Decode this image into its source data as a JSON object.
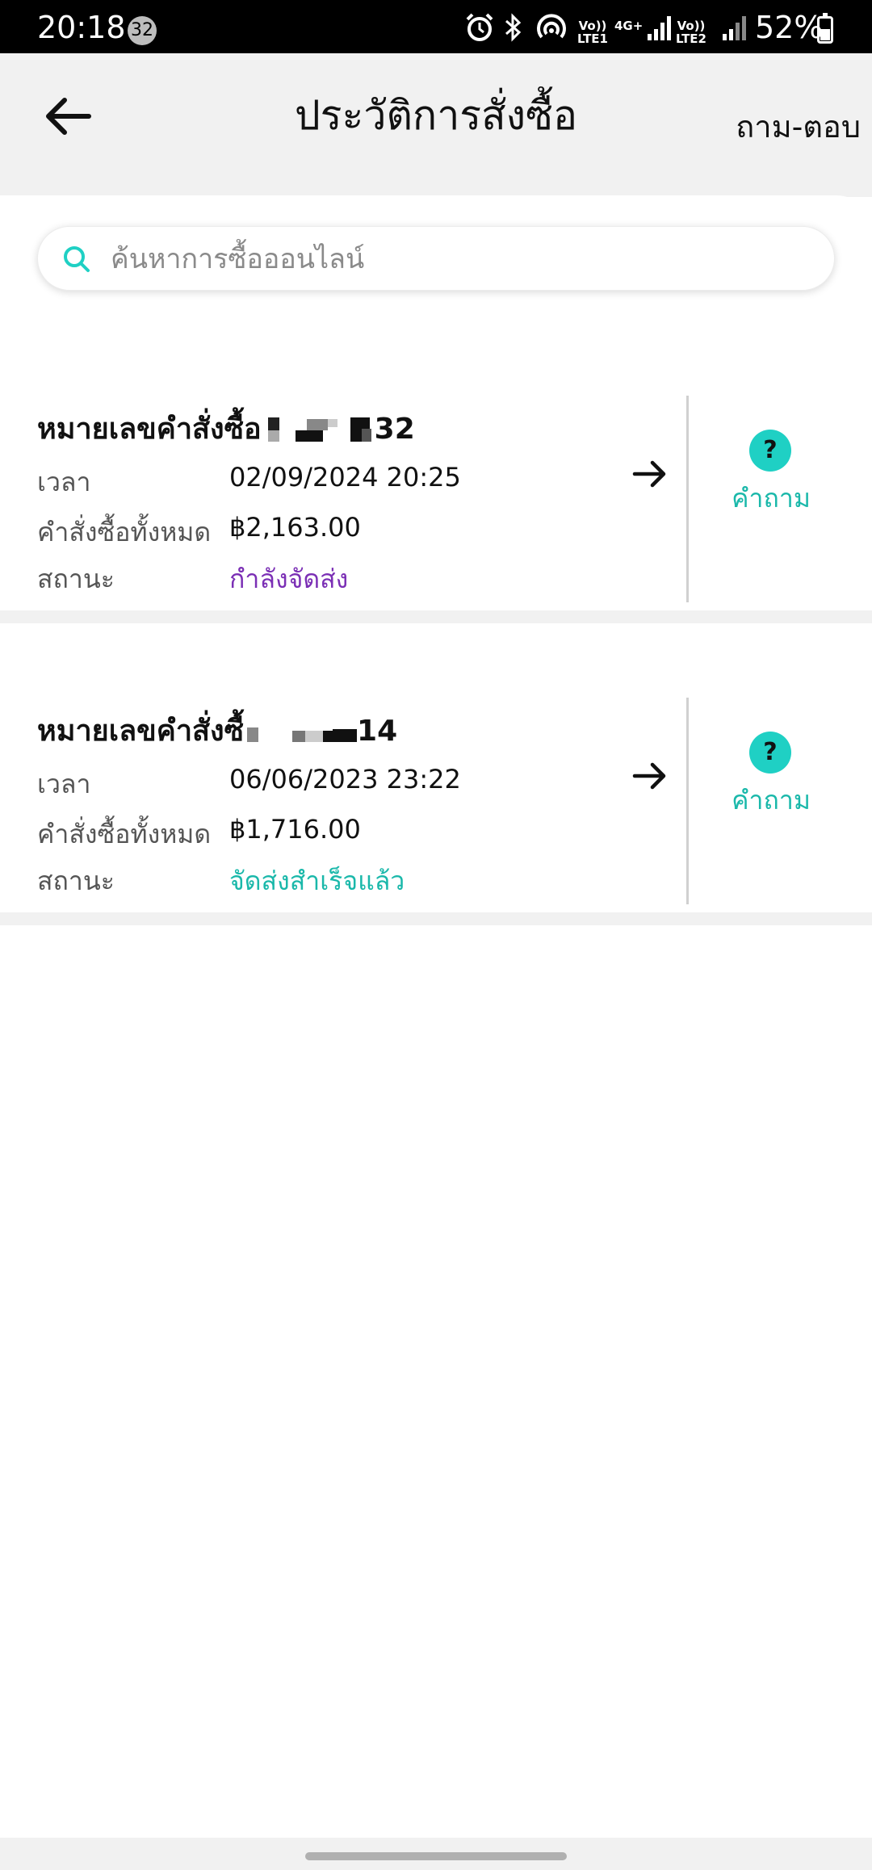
{
  "status_bar": {
    "time": "20:18",
    "notification_count": "32",
    "sim1_label": "Vo)) LTE1",
    "network_label": "4G+",
    "sim2_label": "Vo)) LTE2",
    "battery": "52%"
  },
  "header": {
    "title": "ประวัติการสั่งซื้อ",
    "help_link": "ถาม-ตอบ"
  },
  "search": {
    "placeholder": "ค้นหาการซื้อออนไลน์"
  },
  "labels": {
    "time": "เวลา",
    "total": "คำสั่งซื้อทั้งหมด",
    "status": "สถานะ",
    "question": "คำถาม"
  },
  "orders": [
    {
      "order_prefix": "หมายเลขคำสั่งซื้อ",
      "order_suffix": "32",
      "time": "02/09/2024 20:25",
      "total": "฿2,163.00",
      "status": "กำลังจัดส่ง",
      "status_color": "#7b2fb5"
    },
    {
      "order_prefix": "หมายเลขคำสั่งซื้",
      "order_suffix": "14",
      "time": "06/06/2023 23:22",
      "total": "฿1,716.00",
      "status": "จัดส่งสำเร็จแล้ว",
      "status_color": "#1ab8aa"
    }
  ],
  "colors": {
    "accent": "#1fd0c4",
    "header_bg": "#f1f1f1"
  },
  "icons": [
    "back-arrow-icon",
    "search-icon",
    "arrow-right-icon",
    "question-icon",
    "alarm-icon",
    "bluetooth-icon",
    "hotspot-icon",
    "signal-icon",
    "battery-icon"
  ]
}
